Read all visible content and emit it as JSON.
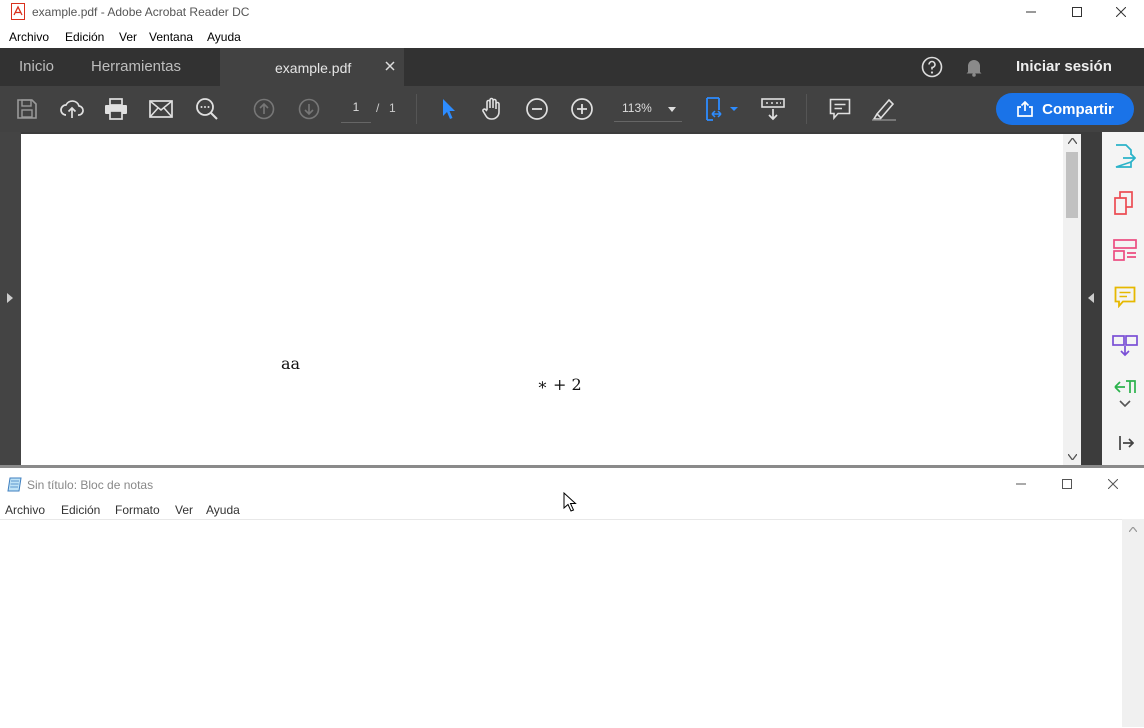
{
  "acrobat": {
    "title": "example.pdf - Adobe Acrobat Reader DC",
    "menu": [
      "Archivo",
      "Edición",
      "Ver",
      "Ventana",
      "Ayuda"
    ],
    "tabs": {
      "home": "Inicio",
      "tools": "Herramientas",
      "document": "example.pdf"
    },
    "sign_in": "Iniciar sesión",
    "page_current": "1",
    "page_sep": "/",
    "page_total": "1",
    "zoom": "113%",
    "share_label": "Compartir",
    "document_text": {
      "line1": "aa",
      "line2": "∗ + 2"
    }
  },
  "notepad": {
    "title": "Sin título: Bloc de notas",
    "menu": [
      "Archivo",
      "Edición",
      "Formato",
      "Ver",
      "Ayuda"
    ],
    "content": ""
  },
  "colors": {
    "acrobat_dark": "#323232",
    "toolbar": "#424242",
    "accent": "#1a73e8"
  }
}
